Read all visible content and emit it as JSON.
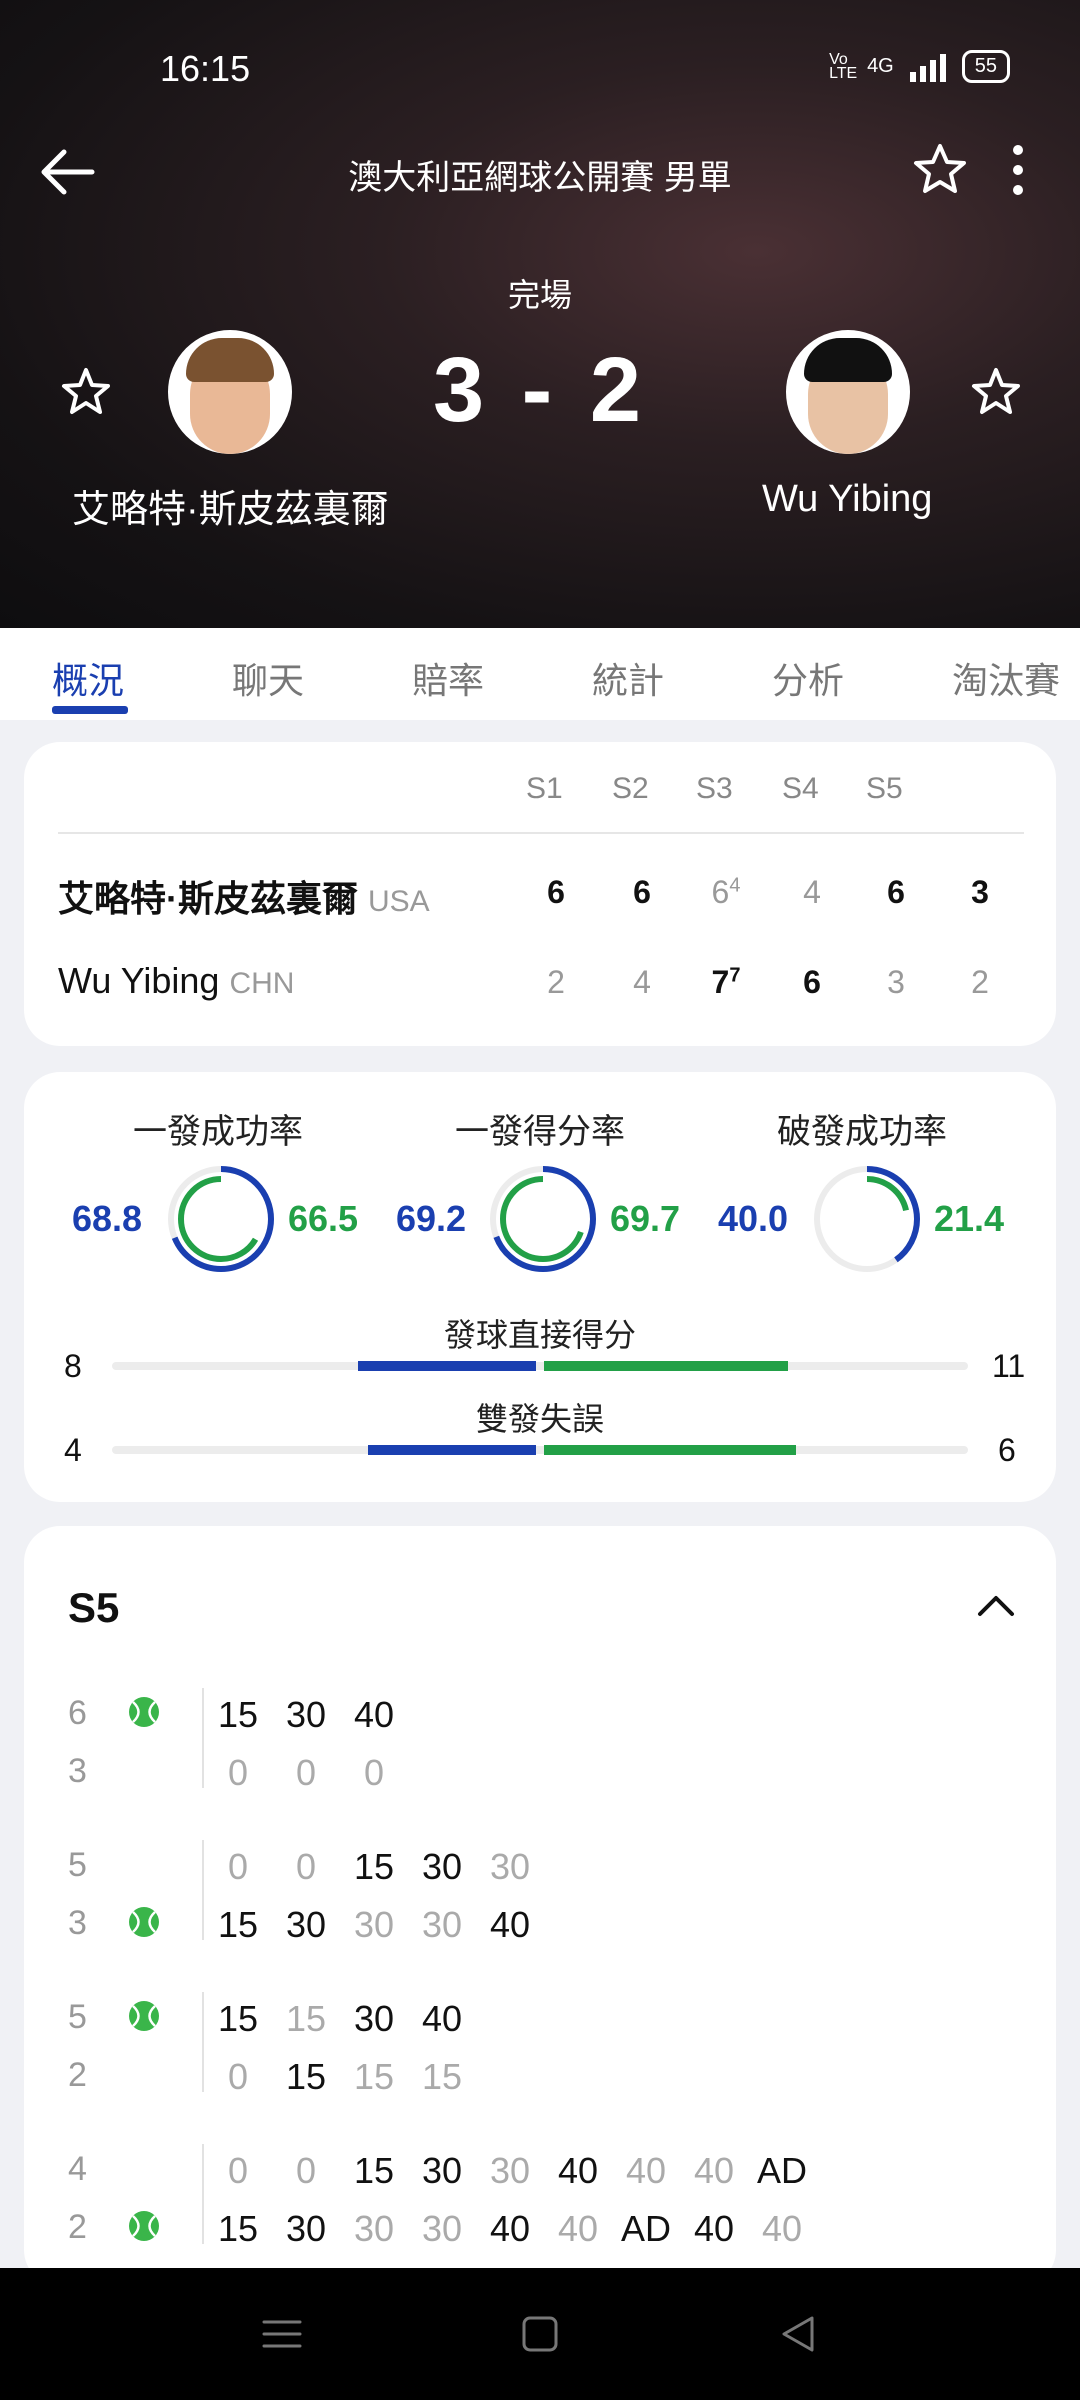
{
  "status": {
    "time": "16:15",
    "network": "4G",
    "volte": "Vo LTE",
    "battery": "55"
  },
  "header": {
    "title": "澳大利亞網球公開賽 男單",
    "match_status": "完場",
    "score": "3 - 2"
  },
  "players": {
    "home": {
      "name": "艾略特·斯皮茲裏爾",
      "country": "USA"
    },
    "away": {
      "name": "Wu Yibing",
      "country": "CHN"
    }
  },
  "tabs": [
    "概況",
    "聊天",
    "賠率",
    "統計",
    "分析",
    "淘汰賽"
  ],
  "sets": {
    "headers": [
      "S1",
      "S2",
      "S3",
      "S4",
      "S5"
    ],
    "home": [
      "6",
      "6",
      "6",
      "4",
      "6",
      "3"
    ],
    "home_tb": [
      "",
      "",
      "4",
      "",
      "",
      ""
    ],
    "away": [
      "2",
      "4",
      "7",
      "6",
      "3",
      "2"
    ],
    "away_tb": [
      "",
      "",
      "7",
      "",
      "",
      ""
    ]
  },
  "stats": [
    {
      "label": "一發成功率",
      "home": "68.8",
      "away": "66.5"
    },
    {
      "label": "一發得分率",
      "home": "69.2",
      "away": "69.7"
    },
    {
      "label": "破發成功率",
      "home": "40.0",
      "away": "21.4"
    }
  ],
  "bars": [
    {
      "label": "發球直接得分",
      "home": "8",
      "away": "11"
    },
    {
      "label": "雙發失誤",
      "home": "4",
      "away": "6"
    }
  ],
  "s5": {
    "title": "S5",
    "games": [
      {
        "home_games": "6",
        "away_games": "3",
        "home_pts": [
          "15",
          "30",
          "40"
        ],
        "away_pts": [
          "0",
          "0",
          "0"
        ]
      },
      {
        "home_games": "5",
        "away_games": "3",
        "home_pts": [
          "0",
          "0",
          "15",
          "30",
          "30"
        ],
        "away_pts": [
          "15",
          "30",
          "30",
          "30",
          "40"
        ]
      },
      {
        "home_games": "5",
        "away_games": "2",
        "home_pts": [
          "15",
          "15",
          "30",
          "40"
        ],
        "away_pts": [
          "0",
          "15",
          "15",
          "15"
        ]
      },
      {
        "home_games": "4",
        "away_games": "2",
        "home_pts": [
          "0",
          "0",
          "15",
          "30",
          "30",
          "40",
          "40",
          "40",
          "AD"
        ],
        "away_pts": [
          "15",
          "30",
          "30",
          "30",
          "40",
          "40",
          "AD",
          "40",
          "40"
        ]
      }
    ]
  },
  "colors": {
    "accent": "#1a3fb0",
    "green": "#22a047"
  },
  "icons": [
    "back-arrow-icon",
    "star-icon",
    "more-vert-icon",
    "tennis-ball-icon",
    "chevron-up-icon",
    "menu-icon",
    "home-square-icon",
    "back-triangle-icon"
  ]
}
